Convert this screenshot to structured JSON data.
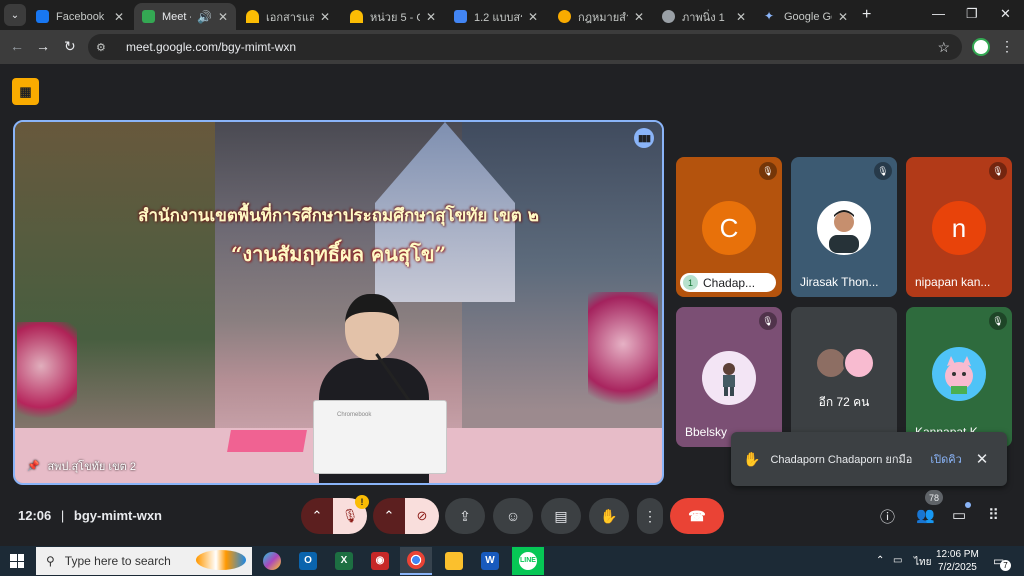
{
  "browser": {
    "tabs": [
      {
        "label": "Facebook",
        "color": "#1877f2"
      },
      {
        "label": "Meet - b",
        "color": "#34a853",
        "audio": "🔊"
      },
      {
        "label": "เอกสารและไฟเ",
        "color": "#fbbc04"
      },
      {
        "label": "หน่วย 5 - Go",
        "color": "#fbbc04"
      },
      {
        "label": "1.2 แบบสรุปผ",
        "color": "#4285f4"
      },
      {
        "label": "กฎหมายสำหรั",
        "color": "#f9ab00"
      },
      {
        "label": "ภาพนิ่ง 1",
        "color": "#9aa0a6"
      },
      {
        "label": "Google Gem",
        "color": "#8ab4f8"
      }
    ],
    "new_tab": "+",
    "url": "meet.google.com/bgy-mimt-wxn",
    "window_controls": [
      "—",
      "❐",
      "✕"
    ]
  },
  "meet": {
    "main_tile": {
      "banner_line1": "สำนักงานเขตพื้นที่การศึกษาประถมศึกษาสุโขทัย เขต ๒",
      "banner_line2": "“งานสัมฤทธิ์ผล คนสุโข”",
      "name": "สพป.สุโขทัย เขต 2",
      "laptop_brand": "Chromebook"
    },
    "participants": [
      {
        "name": "Chadap...",
        "initial": "C",
        "bg": "#b4530d",
        "avatar_bg": "#e8710a",
        "hand": "1"
      },
      {
        "name": "Jirasak Thon...",
        "initial": "",
        "bg": "#3c5a72"
      },
      {
        "name": "nipapan kan...",
        "initial": "n",
        "bg": "#b23a18",
        "avatar_bg": "#e8430a"
      },
      {
        "name": "Bbelsky",
        "initial": "",
        "bg": "#7b4f74"
      },
      {
        "name": "อีก 72 คน",
        "initial": "",
        "bg": "#3c4043"
      },
      {
        "name": "Kannapat K...",
        "initial": "",
        "bg": "#2e6b3d"
      }
    ],
    "toast": {
      "message": "Chadaporn Chadaporn ยกมือ",
      "action": "เปิดคิว"
    },
    "bottom_bar": {
      "time": "12:06",
      "meeting_code": "bgy-mimt-wxn",
      "people_count": "78",
      "warning": "!"
    }
  },
  "taskbar": {
    "search_placeholder": "Type here to search",
    "time": "12:06 PM",
    "date": "7/2/2025",
    "language": "ไทย",
    "notifications": "7"
  }
}
